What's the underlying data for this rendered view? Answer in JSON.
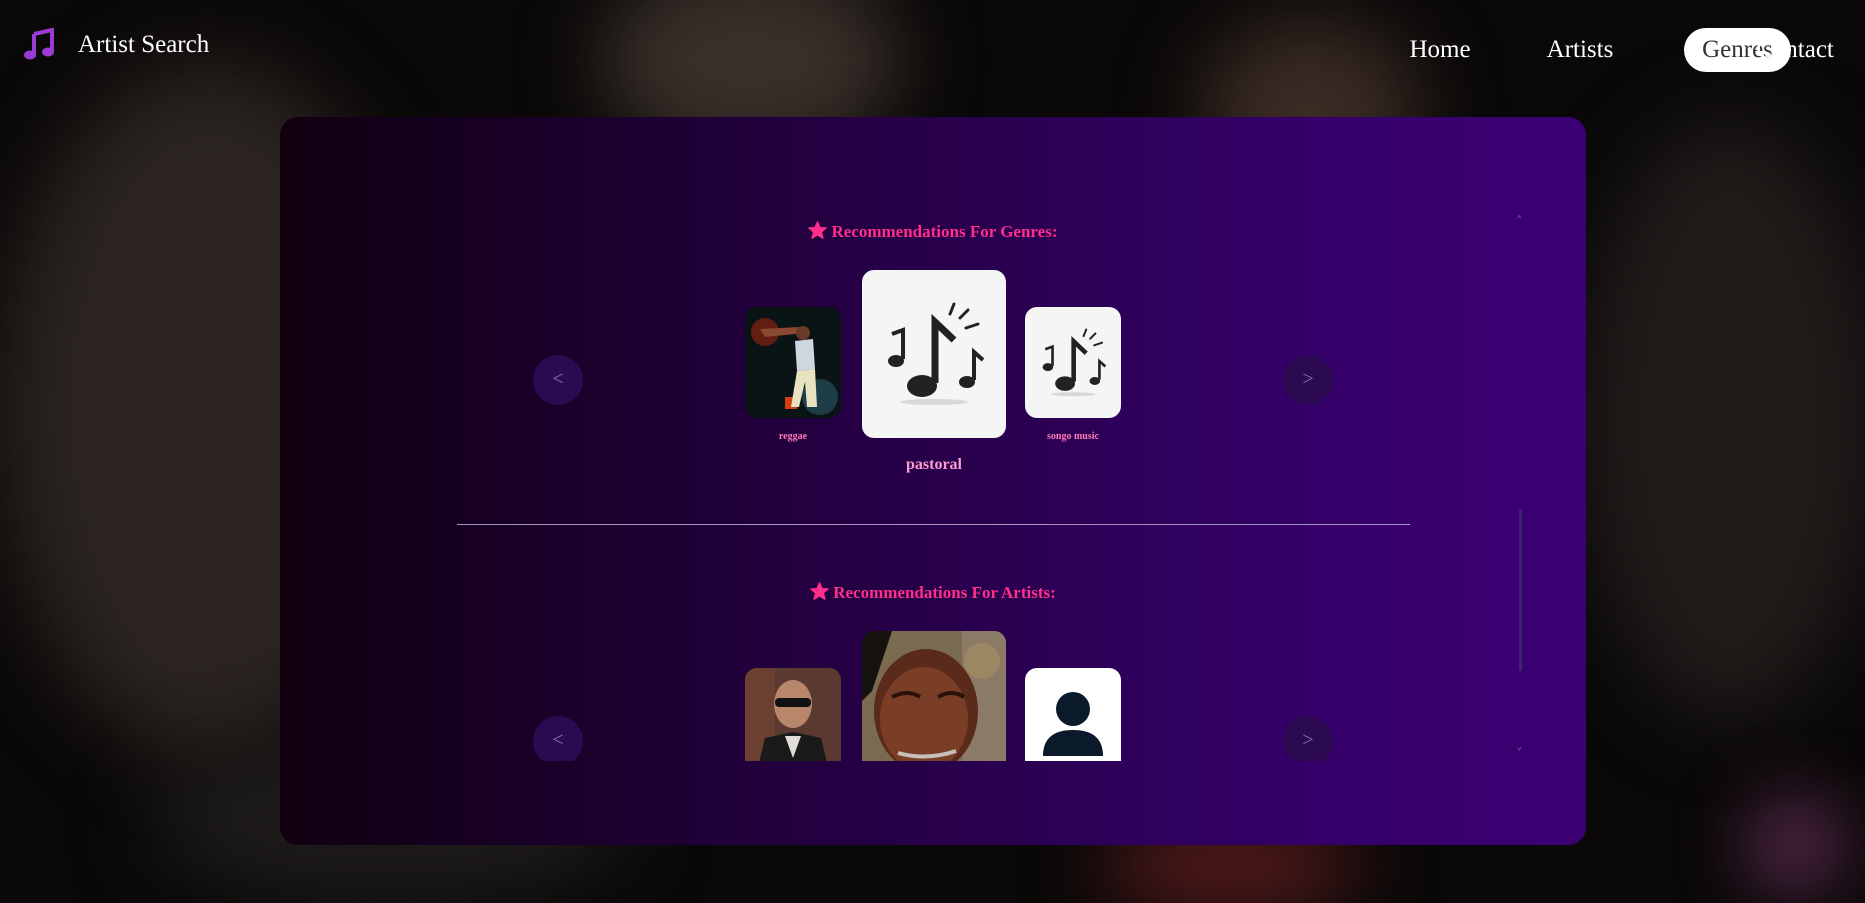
{
  "app": {
    "title": "Artist Search",
    "accent": "#ff2e8a",
    "logo_icon": "music-note-icon"
  },
  "nav": {
    "items": [
      {
        "label": "Home",
        "active": false
      },
      {
        "label": "Artists",
        "active": false
      },
      {
        "label": "Genres",
        "active": true
      },
      {
        "label": "Contact",
        "active": false
      }
    ]
  },
  "genres_section": {
    "title": "Recommendations For Genres:",
    "prev_label": "<",
    "next_label": ">",
    "items": [
      {
        "name": "reggae",
        "image": "performer-photo"
      },
      {
        "name": "pastoral",
        "image": "music-notes-icon",
        "featured": true
      },
      {
        "name": "songo music",
        "image": "music-notes-icon"
      }
    ]
  },
  "artists_section": {
    "title": "Recommendations For Artists:",
    "prev_label": "<",
    "next_label": ">",
    "items": [
      {
        "image": "artist-photo-sunglasses"
      },
      {
        "image": "artist-photo-portrait",
        "featured": true
      },
      {
        "image": "avatar-placeholder-icon"
      }
    ]
  },
  "scroll": {
    "up_label": "˄",
    "down_label": "˅"
  }
}
